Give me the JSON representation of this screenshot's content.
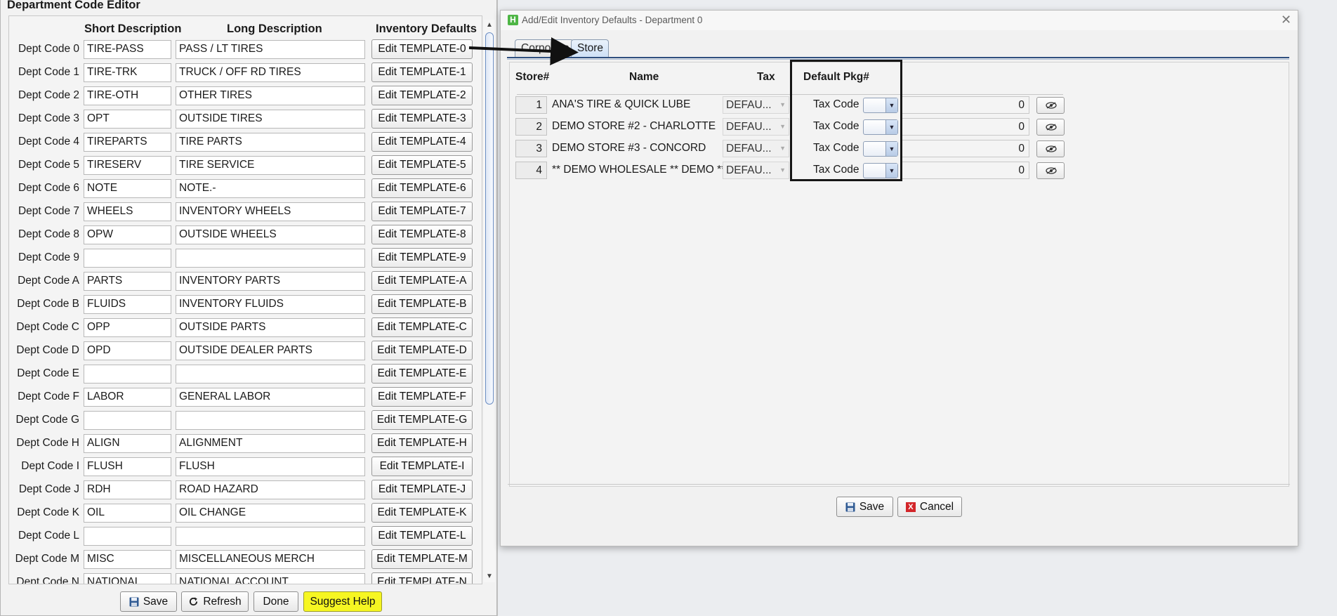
{
  "editor": {
    "title": "Department Code Editor",
    "headers": {
      "short": "Short Description",
      "long": "Long Description",
      "defaults": "Inventory Defaults"
    },
    "rows": [
      {
        "label": "Dept Code 0",
        "short": "TIRE-PASS",
        "long": "PASS / LT TIRES",
        "button": "Edit TEMPLATE-0"
      },
      {
        "label": "Dept Code 1",
        "short": "TIRE-TRK",
        "long": "TRUCK / OFF RD TIRES",
        "button": "Edit TEMPLATE-1"
      },
      {
        "label": "Dept Code 2",
        "short": "TIRE-OTH",
        "long": "OTHER TIRES",
        "button": "Edit TEMPLATE-2"
      },
      {
        "label": "Dept Code 3",
        "short": "OPT",
        "long": "OUTSIDE TIRES",
        "button": "Edit TEMPLATE-3"
      },
      {
        "label": "Dept Code 4",
        "short": "TIREPARTS",
        "long": "TIRE PARTS",
        "button": "Edit TEMPLATE-4"
      },
      {
        "label": "Dept Code 5",
        "short": "TIRESERV",
        "long": "TIRE SERVICE",
        "button": "Edit TEMPLATE-5"
      },
      {
        "label": "Dept Code 6",
        "short": "NOTE",
        "long": "NOTE.-",
        "button": "Edit TEMPLATE-6"
      },
      {
        "label": "Dept Code 7",
        "short": "WHEELS",
        "long": "INVENTORY WHEELS",
        "button": "Edit TEMPLATE-7"
      },
      {
        "label": "Dept Code 8",
        "short": "OPW",
        "long": "OUTSIDE WHEELS",
        "button": "Edit TEMPLATE-8"
      },
      {
        "label": "Dept Code 9",
        "short": "",
        "long": "",
        "button": "Edit TEMPLATE-9"
      },
      {
        "label": "Dept Code A",
        "short": "PARTS",
        "long": "INVENTORY PARTS",
        "button": "Edit TEMPLATE-A"
      },
      {
        "label": "Dept Code B",
        "short": "FLUIDS",
        "long": "INVENTORY FLUIDS",
        "button": "Edit TEMPLATE-B"
      },
      {
        "label": "Dept Code C",
        "short": "OPP",
        "long": "OUTSIDE PARTS",
        "button": "Edit TEMPLATE-C"
      },
      {
        "label": "Dept Code D",
        "short": "OPD",
        "long": "OUTSIDE DEALER PARTS",
        "button": "Edit TEMPLATE-D"
      },
      {
        "label": "Dept Code E",
        "short": "",
        "long": "",
        "button": "Edit TEMPLATE-E"
      },
      {
        "label": "Dept Code F",
        "short": "LABOR",
        "long": "GENERAL LABOR",
        "button": "Edit TEMPLATE-F"
      },
      {
        "label": "Dept Code G",
        "short": "",
        "long": "",
        "button": "Edit TEMPLATE-G"
      },
      {
        "label": "Dept Code H",
        "short": "ALIGN",
        "long": "ALIGNMENT",
        "button": "Edit TEMPLATE-H"
      },
      {
        "label": "Dept Code I",
        "short": "FLUSH",
        "long": "FLUSH",
        "button": "Edit TEMPLATE-I"
      },
      {
        "label": "Dept Code J",
        "short": "RDH",
        "long": "ROAD HAZARD",
        "button": "Edit TEMPLATE-J"
      },
      {
        "label": "Dept Code K",
        "short": "OIL",
        "long": "OIL CHANGE",
        "button": "Edit TEMPLATE-K"
      },
      {
        "label": "Dept Code L",
        "short": "",
        "long": "",
        "button": "Edit TEMPLATE-L"
      },
      {
        "label": "Dept Code M",
        "short": "MISC",
        "long": "MISCELLANEOUS MERCH",
        "button": "Edit TEMPLATE-M"
      },
      {
        "label": "Dept Code N",
        "short": "NATIONAL",
        "long": "NATIONAL ACCOUNT",
        "button": "Edit TEMPLATE-N"
      }
    ],
    "footer": {
      "save": "Save",
      "refresh": "Refresh",
      "done": "Done",
      "help": "Suggest Help"
    }
  },
  "dialog": {
    "title": "Add/Edit Inventory Defaults - Department 0",
    "tabs": {
      "corporate": "Corporate",
      "store": "Store"
    },
    "headers": {
      "store": "Store#",
      "name": "Name",
      "tax": "Tax",
      "pkg": "Default Pkg#"
    },
    "stores": [
      {
        "num": "1",
        "name": "ANA'S TIRE & QUICK LUBE",
        "tax": "DEFAU...",
        "taxcode_label": "Tax Code",
        "pkg": "0"
      },
      {
        "num": "2",
        "name": "DEMO STORE #2  - CHARLOTTE",
        "tax": "DEFAU...",
        "taxcode_label": "Tax Code",
        "pkg": "0"
      },
      {
        "num": "3",
        "name": "DEMO STORE #3 - CONCORD",
        "tax": "DEFAU...",
        "taxcode_label": "Tax Code",
        "pkg": "0"
      },
      {
        "num": "4",
        "name": "** DEMO WHOLESALE ** DEMO **",
        "tax": "DEFAU...",
        "taxcode_label": "Tax Code",
        "pkg": "0"
      }
    ],
    "buttons": {
      "save": "Save",
      "cancel": "Cancel"
    }
  },
  "icons": {
    "save": "floppy-icon",
    "refresh": "refresh-icon",
    "cancel": "red-x-icon",
    "view": "eye-icon",
    "close": "close-icon",
    "app": "app-h-icon"
  },
  "colors": {
    "help_button": "#f6f622",
    "highlight_box": "#161616",
    "cancel_icon": "#d3262a"
  }
}
